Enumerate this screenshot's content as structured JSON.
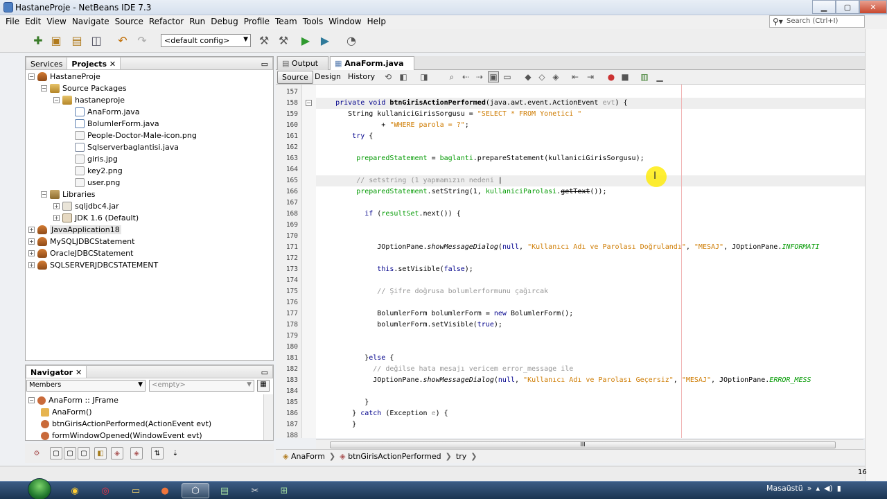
{
  "window": {
    "title": "HastaneProje - NetBeans IDE 7.3"
  },
  "menu": [
    "File",
    "Edit",
    "View",
    "Navigate",
    "Source",
    "Refactor",
    "Run",
    "Debug",
    "Profile",
    "Team",
    "Tools",
    "Window",
    "Help"
  ],
  "search": {
    "placeholder": "Search (Ctrl+I)"
  },
  "toolbar": {
    "config": "<default config>"
  },
  "left_panel": {
    "tabs": [
      "Services",
      "Projects"
    ],
    "tree": [
      {
        "label": "HastaneProje",
        "level": 0,
        "icon": "project-icon",
        "toggle": "−"
      },
      {
        "label": "Source Packages",
        "level": 1,
        "icon": "source-packages-icon",
        "toggle": "−"
      },
      {
        "label": "hastaneproje",
        "level": 2,
        "icon": "package-icon",
        "toggle": "−"
      },
      {
        "label": "AnaForm.java",
        "level": 3,
        "icon": "form-file-icon",
        "toggle": ""
      },
      {
        "label": "BolumlerForm.java",
        "level": 3,
        "icon": "form-file-icon",
        "toggle": ""
      },
      {
        "label": "People-Doctor-Male-icon.png",
        "level": 3,
        "icon": "image-file-icon",
        "toggle": ""
      },
      {
        "label": "Sqlserverbaglantisi.java",
        "level": 3,
        "icon": "java-file-icon",
        "toggle": ""
      },
      {
        "label": "giris.jpg",
        "level": 3,
        "icon": "image-file-icon",
        "toggle": ""
      },
      {
        "label": "key2.png",
        "level": 3,
        "icon": "image-file-icon",
        "toggle": ""
      },
      {
        "label": "user.png",
        "level": 3,
        "icon": "image-file-icon",
        "toggle": ""
      },
      {
        "label": "Libraries",
        "level": 1,
        "icon": "libraries-icon",
        "toggle": "−"
      },
      {
        "label": "sqljdbc4.jar",
        "level": 2,
        "icon": "jar-icon",
        "toggle": "+"
      },
      {
        "label": "JDK 1.6 (Default)",
        "level": 2,
        "icon": "jdk-icon",
        "toggle": "+"
      },
      {
        "label": "JavaApplication18",
        "level": 0,
        "icon": "project-icon",
        "toggle": "+",
        "selected": true
      },
      {
        "label": "MySQLJDBCStatement",
        "level": 0,
        "icon": "project-icon",
        "toggle": "+"
      },
      {
        "label": "OracleJDBCStatement",
        "level": 0,
        "icon": "project-icon",
        "toggle": "+"
      },
      {
        "label": "SQLSERVERJDBCSTATEMENT",
        "level": 0,
        "icon": "project-icon",
        "toggle": "+"
      }
    ]
  },
  "navigator": {
    "title": "Navigator",
    "filter": "Members",
    "filter2": "<empty>",
    "items": [
      {
        "label": "AnaForm :: JFrame",
        "level": 0
      },
      {
        "label": "AnaForm()",
        "level": 1
      },
      {
        "label": "btnGirisActionPerformed(ActionEvent evt)",
        "level": 1
      },
      {
        "label": "formWindowOpened(WindowEvent evt)",
        "level": 1
      }
    ]
  },
  "editor": {
    "tabs": [
      "Output",
      "AnaForm.java"
    ],
    "active_tab": "AnaForm.java",
    "views": [
      "Source",
      "Design",
      "History"
    ],
    "lines": [
      {
        "n": "157",
        "html": ""
      },
      {
        "n": "158",
        "html": "    <span class='kw'>private void</span> <b>btnGirisActionPerformed</b>(java.awt.event.ActionEvent <span class='cm'>evt</span>) {",
        "fold": "−",
        "hl": true
      },
      {
        "n": "159",
        "html": "       String kullaniciGirisSorgusu = <span class='st'>\"SELECT * FROM Yonetici \"</span>"
      },
      {
        "n": "160",
        "html": "               + <span class='st'>\"WHERE parola = ?\"</span>;"
      },
      {
        "n": "161",
        "html": "        <span class='kw'>try</span> {"
      },
      {
        "n": "162",
        "html": ""
      },
      {
        "n": "163",
        "html": "         <span class='fd'>preparedStatement</span> = <span class='fd'>baglanti</span>.prepareStatement(kullaniciGirisSorgusu);"
      },
      {
        "n": "164",
        "html": ""
      },
      {
        "n": "165",
        "html": "         <span class='cm'>// setstring (1 yapmamızın nedeni </span>|",
        "hl": true
      },
      {
        "n": "166",
        "html": "         <span class='fd'>preparedStatement</span>.setString(1, <span class='fd'>kullaniciParolasi</span>.<span class='ln-strike'>getText</span>());"
      },
      {
        "n": "167",
        "html": ""
      },
      {
        "n": "168",
        "html": "           <span class='kw'>if</span> (<span class='fd'>resultSet</span>.next()) {"
      },
      {
        "n": "169",
        "html": ""
      },
      {
        "n": "170",
        "html": ""
      },
      {
        "n": "171",
        "html": "              JOptionPane.<span class='it'>showMessageDialog</span>(<span class='kw'>null</span>, <span class='st'>\"Kullanıcı Adı ve Parolası Doğrulandı\"</span>, <span class='st'>\"MESAJ\"</span>, JOptionPane.<span class='fd it'>INFORMATI</span>"
      },
      {
        "n": "172",
        "html": ""
      },
      {
        "n": "173",
        "html": "              <span class='kw'>this</span>.setVisible(<span class='kw'>false</span>);"
      },
      {
        "n": "174",
        "html": ""
      },
      {
        "n": "175",
        "html": "              <span class='cm'>// Şifre doğrusa bolumlerformunu çağırcak</span>"
      },
      {
        "n": "176",
        "html": ""
      },
      {
        "n": "177",
        "html": "              BolumlerForm bolumlerForm = <span class='kw'>new</span> BolumlerForm();"
      },
      {
        "n": "178",
        "html": "              bolumlerForm.setVisible(<span class='kw'>true</span>);"
      },
      {
        "n": "179",
        "html": ""
      },
      {
        "n": "180",
        "html": ""
      },
      {
        "n": "181",
        "html": "           }<span class='kw'>else</span> {"
      },
      {
        "n": "182",
        "html": "             <span class='cm'>// değilse hata mesajı vericem error_message ile</span>"
      },
      {
        "n": "183",
        "html": "             JOptionPane.<span class='it'>showMessageDialog</span>(<span class='kw'>null</span>, <span class='st'>\"Kullanıcı Adı ve Parolası Geçersiz\"</span>, <span class='st'>\"MESAJ\"</span>, JOptionPane.<span class='fd it'>ERROR_MESS</span>"
      },
      {
        "n": "184",
        "html": ""
      },
      {
        "n": "185",
        "html": "           }"
      },
      {
        "n": "186",
        "html": "        } <span class='kw'>catch</span> (Exception <span class='cm'>e</span>) {"
      },
      {
        "n": "187",
        "html": "        }"
      },
      {
        "n": "188",
        "html": ""
      }
    ],
    "scrollbar_label": "III",
    "breadcrumb": [
      "AnaForm",
      "btnGirisActionPerformed",
      "try"
    ]
  },
  "status": {
    "position": "16"
  },
  "taskbar": {
    "tray_label": "Masaüstü",
    "tray_chevron": "»"
  },
  "colors": {
    "keyword": "#00008b",
    "string": "#ce7b00",
    "comment": "#969696",
    "field": "#009900"
  }
}
